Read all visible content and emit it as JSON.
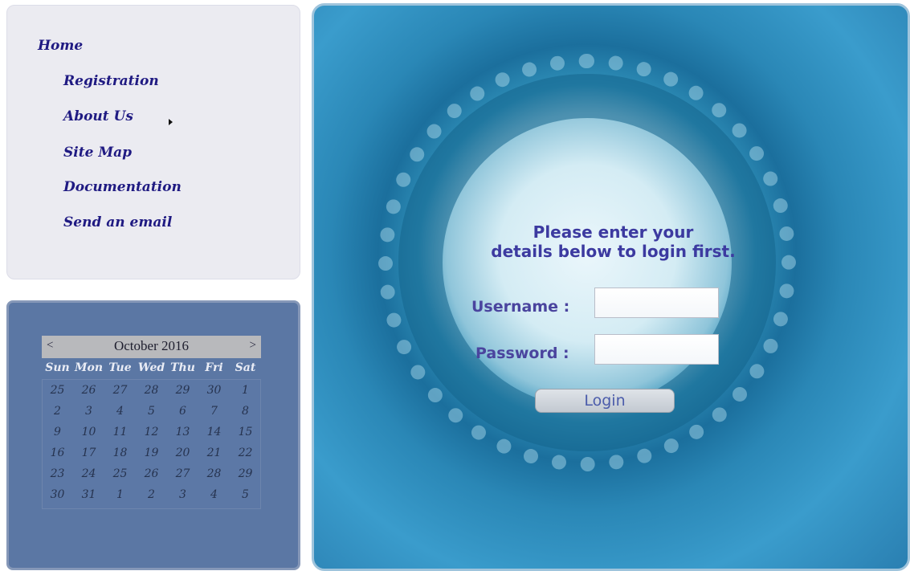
{
  "nav": {
    "home": "Home",
    "registration": "Registration",
    "about": "About Us",
    "sitemap": "Site Map",
    "documentation": "Documentation",
    "email": "Send an email"
  },
  "calendar": {
    "prev": "<",
    "next": ">",
    "title": "October 2016",
    "days_of_week": [
      "Sun",
      "Mon",
      "Tue",
      "Wed",
      "Thu",
      "Fri",
      "Sat"
    ],
    "weeks": [
      [
        "25",
        "26",
        "27",
        "28",
        "29",
        "30",
        "1"
      ],
      [
        "2",
        "3",
        "4",
        "5",
        "6",
        "7",
        "8"
      ],
      [
        "9",
        "10",
        "11",
        "12",
        "13",
        "14",
        "15"
      ],
      [
        "16",
        "17",
        "18",
        "19",
        "20",
        "21",
        "22"
      ],
      [
        "23",
        "24",
        "25",
        "26",
        "27",
        "28",
        "29"
      ],
      [
        "30",
        "31",
        "1",
        "2",
        "3",
        "4",
        "5"
      ]
    ]
  },
  "login": {
    "title_line1": "Please enter your",
    "title_line2": "details below to login first.",
    "username_label": "Username :",
    "password_label": "Password :",
    "username_value": "",
    "password_value": "",
    "button": "Login"
  }
}
